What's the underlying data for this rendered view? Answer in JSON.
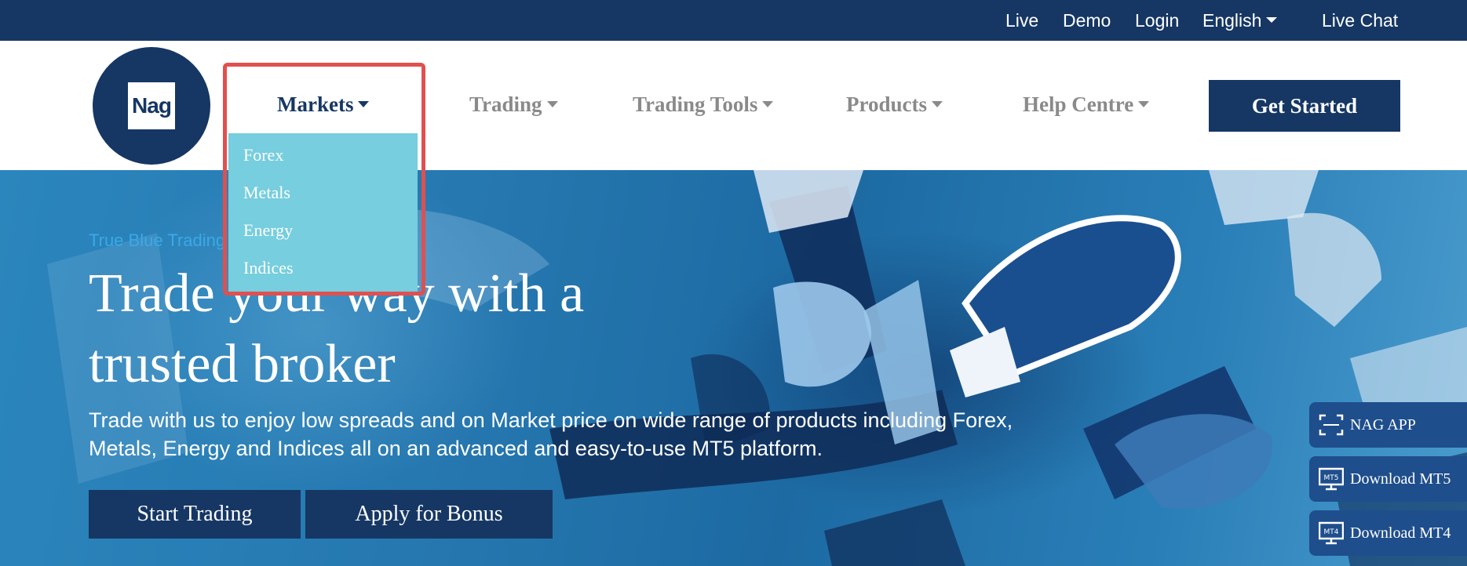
{
  "topbar": {
    "links": [
      "Live",
      "Demo",
      "Login"
    ],
    "language": "English",
    "live_chat": "Live Chat"
  },
  "header": {
    "logo_text": "Nag",
    "nav": [
      {
        "label": "Markets",
        "active": true
      },
      {
        "label": "Trading",
        "active": false
      },
      {
        "label": "Trading Tools",
        "active": false
      },
      {
        "label": "Products",
        "active": false
      },
      {
        "label": "Help Centre",
        "active": false
      }
    ],
    "cta_label": "Get Started"
  },
  "dropdown": {
    "items": [
      "Forex",
      "Metals",
      "Energy",
      "Indices"
    ]
  },
  "hero": {
    "eyebrow": "True Blue Trading",
    "headline_line1": "Trade your way with a",
    "headline_line2": "trusted broker",
    "subtext_line1": "Trade with us to enjoy low spreads and on Market price on wide range of products including Forex,",
    "subtext_line2": "Metals, Energy and Indices all on an advanced and easy-to-use MT5 platform.",
    "buttons": [
      "Start Trading",
      "Apply for Bonus"
    ]
  },
  "side_widget": {
    "items": [
      {
        "label": "NAG APP",
        "icon": "scan-icon"
      },
      {
        "label": "Download MT5",
        "icon": "monitor-mt5-icon",
        "badge": "MT5"
      },
      {
        "label": "Download MT4",
        "icon": "monitor-mt4-icon",
        "badge": "MT4"
      }
    ]
  },
  "colors": {
    "navy": "#163764",
    "dropdown_bg": "#76cede",
    "highlight": "#e0504f",
    "eyebrow": "#3aa9e6"
  }
}
